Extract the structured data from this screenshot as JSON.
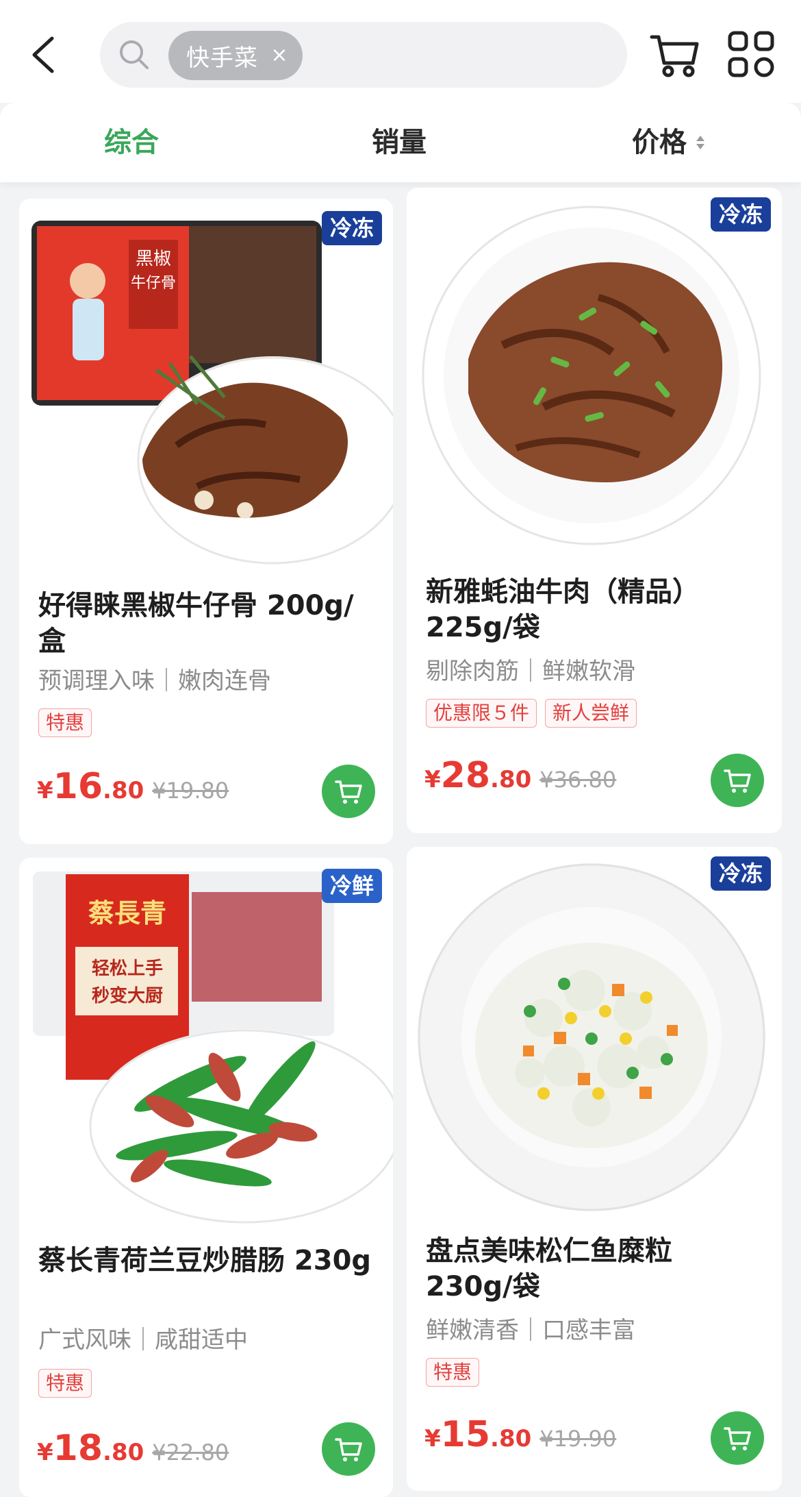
{
  "search": {
    "tag": "快手菜",
    "close": "×"
  },
  "sort": {
    "tabs": [
      "综合",
      "销量",
      "价格"
    ],
    "active": "综合"
  },
  "products": [
    {
      "title": "好得睐黑椒牛仔骨 200g/盒",
      "subtitle": "预调理入味｜嫩肉连骨",
      "badge": "冷冻",
      "tags": [
        "特惠"
      ],
      "price_symbol": "¥",
      "price_int": "16",
      "price_dec": ".80",
      "orig_price": "¥19.80",
      "image": "black-pepper-beef-ribs-image"
    },
    {
      "title": "新雅蚝油牛肉（精品）225g/袋",
      "subtitle": "剔除肉筋｜鲜嫩软滑",
      "badge": "冷冻",
      "tags": [
        "优惠限５件",
        "新人尝鲜"
      ],
      "price_symbol": "¥",
      "price_int": "28",
      "price_dec": ".80",
      "orig_price": "¥36.80",
      "image": "oyster-sauce-beef-image"
    },
    {
      "title": "蔡长青荷兰豆炒腊肠 230g",
      "subtitle": "广式风味｜咸甜适中",
      "badge": "冷鲜",
      "tags": [
        "特惠"
      ],
      "price_symbol": "¥",
      "price_int": "18",
      "price_dec": ".80",
      "orig_price": "¥22.80",
      "image": "snow-peas-sausage-image"
    },
    {
      "title": "盘点美味松仁鱼糜粒 230g/袋",
      "subtitle": "鲜嫩清香｜口感丰富",
      "badge": "冷冻",
      "tags": [
        "特惠"
      ],
      "price_symbol": "¥",
      "price_int": "15",
      "price_dec": ".80",
      "orig_price": "¥19.90",
      "image": "pine-nut-fish-image"
    }
  ],
  "colors": {
    "accent_green": "#3aa75a",
    "price_red": "#e63a33",
    "badge_blue": "#1a3f9a"
  }
}
